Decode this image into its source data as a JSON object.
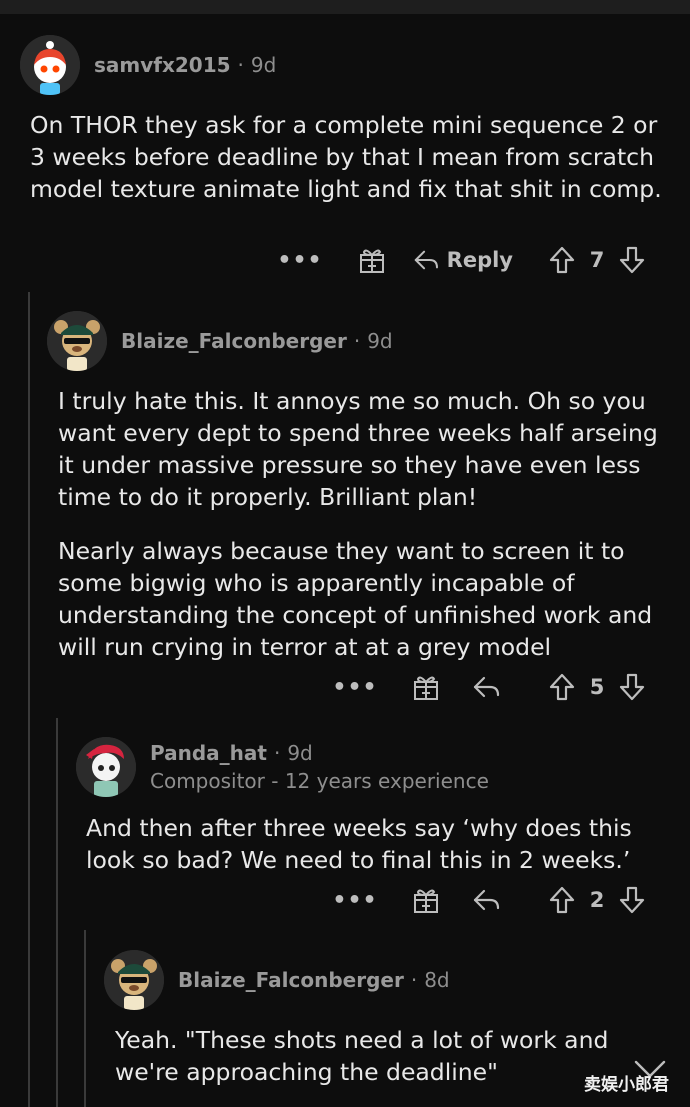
{
  "comments": [
    {
      "username": "samvfx2015",
      "age": "9d",
      "paragraphs": [
        "On THOR they ask for a complete mini sequence 2 or 3 weeks before deadline by that I mean from scratch model texture animate light and fix that shit in comp."
      ],
      "actions": {
        "more": "•••",
        "award_icon": "gift-award-icon",
        "reply_label": "Reply",
        "score": "7"
      }
    },
    {
      "username": "Blaize_Falconberger",
      "age": "9d",
      "paragraphs": [
        "I truly hate this. It annoys me so much. Oh so you want every dept to spend three weeks half arseing it under massive pressure so they have even less time to do it properly. Brilliant plan!",
        "Nearly always because they want to screen it to some bigwig who is apparently incapable of understanding the concept of unfinished work and will run crying in terror at at a grey model"
      ],
      "actions": {
        "more": "•••",
        "award_icon": "gift-award-icon",
        "score": "5"
      }
    },
    {
      "username": "Panda_hat",
      "age": "9d",
      "flair": "Compositor - 12 years experience",
      "paragraphs": [
        "And then after three weeks say ‘why does this look so bad? We need to final this in 2 weeks.’"
      ],
      "actions": {
        "more": "•••",
        "award_icon": "gift-award-icon",
        "score": "2"
      }
    },
    {
      "username": "Blaize_Falconberger",
      "age": "8d",
      "paragraphs": [
        "Yeah. \"These shots need a lot of work and we're approaching the deadline\""
      ]
    }
  ],
  "watermark": "卖娱小郎君",
  "colors": {
    "background": "#0d0d0d",
    "text": "#e8e8e8",
    "muted": "#8e8e8e",
    "thread_line": "#3a3a3a"
  }
}
